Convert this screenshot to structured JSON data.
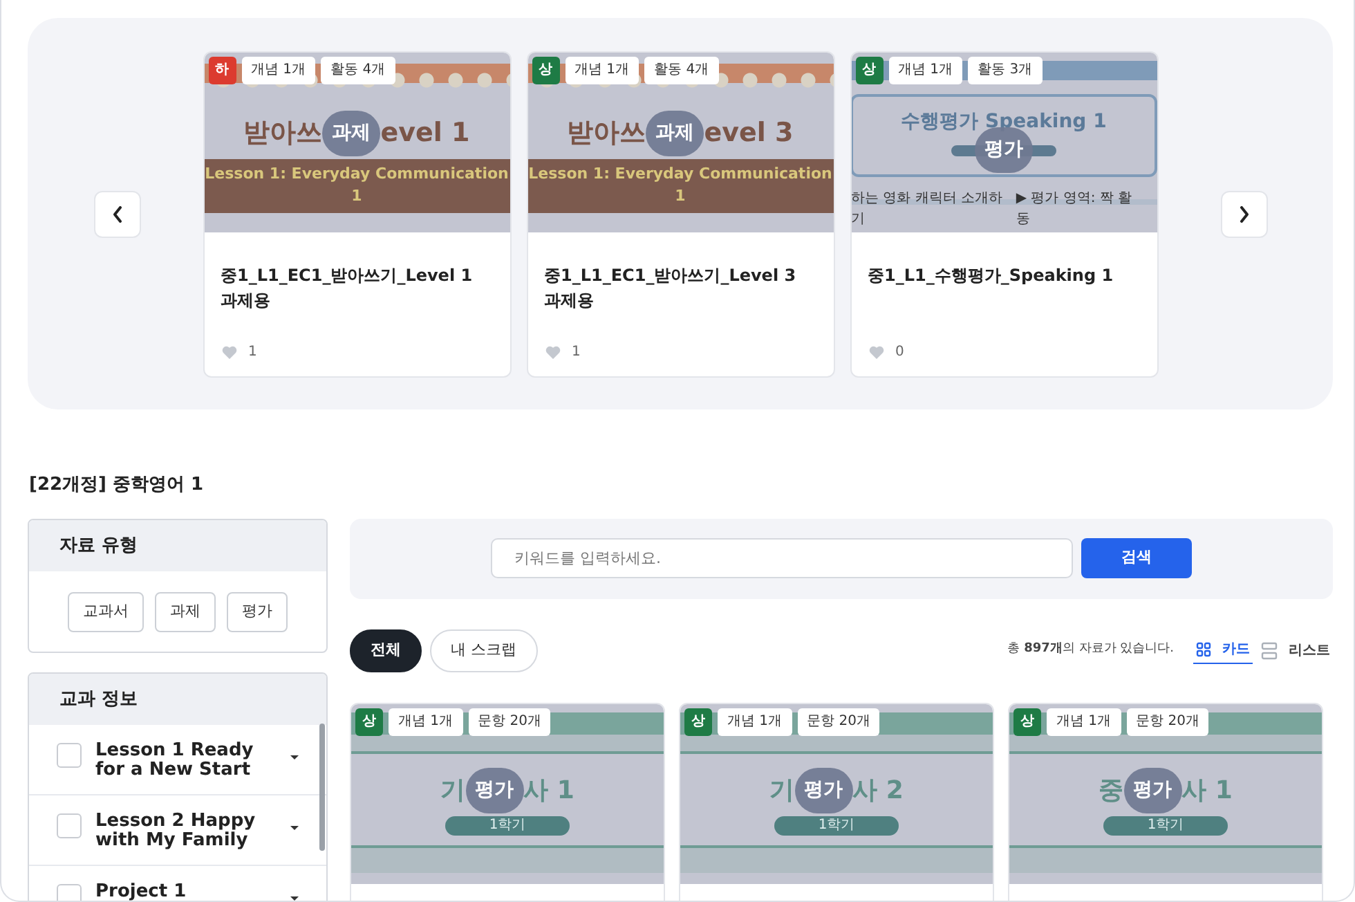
{
  "featured": [
    {
      "level": "하",
      "color": "#dc3b2f",
      "tags": [
        "개념 1개",
        "활동 4개"
      ],
      "thumbnail": {
        "kind": "dictation",
        "title_left": "받아쓰",
        "title_right": "evel 1",
        "subtitle": "Lesson 1: Everyday Communication 1"
      },
      "overlay": "과제",
      "title": "중1_L1_EC1_받아쓰기_Level 1 과제용",
      "likes": "1"
    },
    {
      "level": "상",
      "color": "#1e7b45",
      "tags": [
        "개념 1개",
        "활동 4개"
      ],
      "thumbnail": {
        "kind": "dictation",
        "title_left": "받아쓰",
        "title_right": "evel 3",
        "subtitle": "Lesson 1: Everyday Communication 1"
      },
      "overlay": "과제",
      "title": "중1_L1_EC1_받아쓰기_Level 3 과제용",
      "likes": "1"
    },
    {
      "level": "상",
      "color": "#1e7b45",
      "tags": [
        "개념 1개",
        "활동 3개"
      ],
      "thumbnail": {
        "kind": "speaking",
        "title": "수행평가 Speaking 1",
        "notes": [
          "하는 영화 캐릭터 소개하기",
          "▶ 평가 영역: 짝 활동"
        ]
      },
      "overlay": "평가",
      "title": "중1_L1_수행평가_Speaking 1",
      "likes": "0"
    }
  ],
  "page_title": "[22개정] 중학영어 1",
  "material_type": {
    "title": "자료 유형",
    "buttons": [
      "교과서",
      "과제",
      "평가"
    ]
  },
  "subject_info": {
    "title": "교과 정보",
    "items": [
      {
        "label": "Lesson 1 Ready for a New Start",
        "checked": false
      },
      {
        "label": "Lesson 2 Happy with My Family",
        "checked": false
      },
      {
        "label": "Project 1",
        "checked": false
      }
    ]
  },
  "search": {
    "placeholder": "키워드를 입력하세요.",
    "button": "검색"
  },
  "scope_tabs": [
    {
      "label": "전체",
      "selected": true
    },
    {
      "label": "내 스크랩",
      "selected": false
    }
  ],
  "result_count": "총 **897개**의 자료가 있습니다.",
  "views": [
    {
      "kind": "card",
      "label": "카드",
      "selected": true
    },
    {
      "kind": "list",
      "label": "리스트",
      "selected": false
    }
  ],
  "materials": [
    {
      "level": "상",
      "color": "#1e7b45",
      "tags": [
        "개념 1개",
        "문항 20개"
      ],
      "thumbnail": {
        "kind": "exam",
        "title_left": "기",
        "title_right": "사 1",
        "term": "1학기"
      },
      "overlay": "평가"
    },
    {
      "level": "상",
      "color": "#1e7b45",
      "tags": [
        "개념 1개",
        "문항 20개"
      ],
      "thumbnail": {
        "kind": "exam",
        "title_left": "기",
        "title_right": "사 2",
        "term": "1학기"
      },
      "overlay": "평가"
    },
    {
      "level": "상",
      "color": "#1e7b45",
      "tags": [
        "개념 1개",
        "문항 20개"
      ],
      "thumbnail": {
        "kind": "exam",
        "title_left": "중",
        "title_right": "사 1",
        "term": "1학기"
      },
      "overlay": "평가"
    }
  ]
}
